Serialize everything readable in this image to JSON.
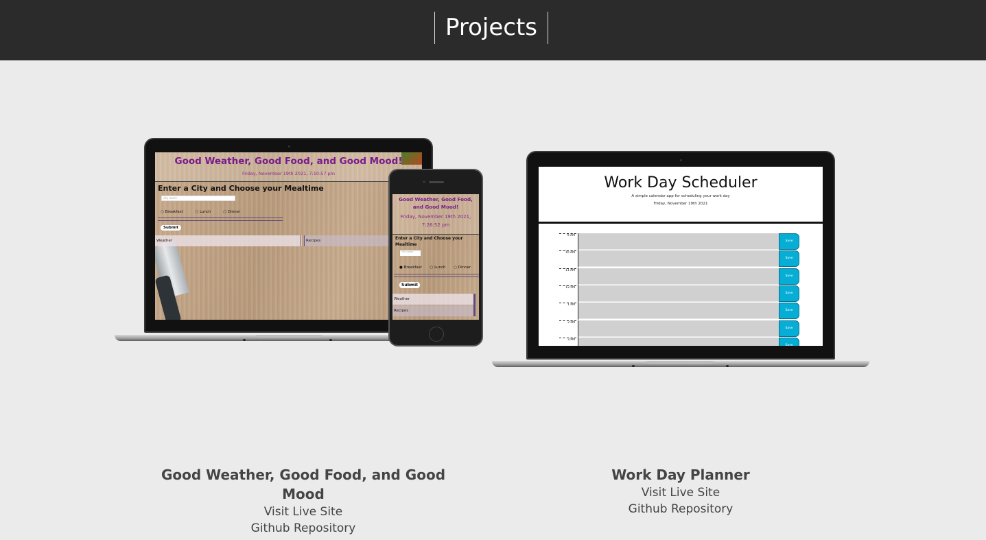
{
  "header": {
    "title": "Projects"
  },
  "projects": [
    {
      "title": "Good Weather, Good Food, and Good Mood",
      "live_label": "Visit Live Site",
      "repo_label": "Github Repository",
      "preview": {
        "laptop": {
          "title": "Good Weather, Good Food, and Good Mood!",
          "date": "Friday, November 19th 2021, 7:10:57 pm",
          "heading": "Enter a City and Choose your Mealtime",
          "input_placeholder": "city name",
          "radios": [
            "Breakfast",
            "Lunch",
            "Dinner"
          ],
          "submit": "Submit",
          "weather": "Weather",
          "recipes": "Recipes"
        },
        "phone": {
          "title": "Good Weather, Good Food, and Good Mood!",
          "date": "Friday, November 19th 2021, 7:26:52 pm",
          "heading": "Enter a City and Choose your Mealtime",
          "input_placeholder": "city name",
          "radios": [
            "Breakfast",
            "Lunch",
            "Dinner"
          ],
          "submit": "Submit",
          "weather": "Weather",
          "recipes": "Recipes"
        }
      }
    },
    {
      "title": "Work Day Planner",
      "live_label": "Visit Live Site",
      "repo_label": "Github Repository",
      "preview": {
        "title": "Work Day Scheduler",
        "subtitle": "A simple calendar app for scheduling your work day",
        "date": "Friday, November 19th 2021",
        "hours": [
          "9 AM",
          "10 AM",
          "11 AM",
          "12 PM",
          "1 PM",
          "2 PM",
          "3 PM"
        ],
        "save_label": "Save"
      }
    }
  ],
  "colors": {
    "header_bg": "#2b2b2b",
    "page_bg": "#ebebeb",
    "accent_purple": "#7a1a8c",
    "save_blue": "#06aed5"
  }
}
